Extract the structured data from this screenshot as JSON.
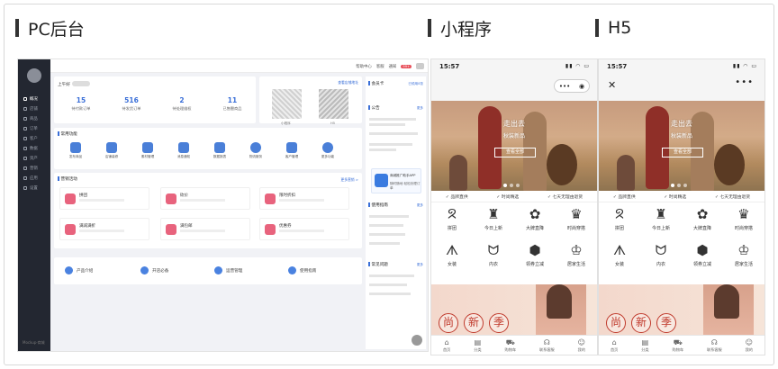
{
  "headers": {
    "pc": "PC后台",
    "mini": "小程序",
    "h5": "H5"
  },
  "pc": {
    "sidebar": [
      "概况",
      "店铺",
      "商品",
      "订单",
      "客户",
      "数据",
      "资产",
      "营销",
      "应用",
      "设置"
    ],
    "sidebar_footer": "Mockup·商城",
    "topbar": {
      "help": "帮助中心",
      "service": "客服",
      "notice": "通知",
      "badge": "99+"
    },
    "greeting": "上午好",
    "stats": [
      {
        "value": "15",
        "label": "待付款订单"
      },
      {
        "value": "516",
        "label": "待发货订单"
      },
      {
        "value": "2",
        "label": "待处理维权"
      },
      {
        "value": "11",
        "label": "已售罄商品"
      }
    ],
    "qr_link": "查看店铺地址",
    "qr_labels": [
      "小程序",
      "H5"
    ],
    "common_title": "常用功能",
    "common": [
      "发布商品",
      "店铺装修",
      "素材管理",
      "消息通知",
      "数据报表",
      "物流服务",
      "客户管理",
      "更多功能"
    ],
    "marketing_title": "营销活动",
    "marketing_more": "更多营销 >",
    "marketing": [
      "拼团",
      "砍价",
      "限时折扣",
      "满减满折",
      "满包邮",
      "优惠券"
    ],
    "bottom": [
      "产品介绍",
      "开店必备",
      "运营管理",
      "使用指南"
    ],
    "right": {
      "member": "会员卡",
      "member_link": "已领用0张",
      "notice": "公告",
      "notice_more": "更多",
      "app_name": "商城推广助手APP",
      "app_desc": "随时随地 轻松处理订单",
      "guide": "使用指南",
      "guide_more": "更多",
      "faq": "常见问题",
      "faq_more": "更多"
    }
  },
  "phones": {
    "time": "15:57",
    "hero_title": "走出去",
    "hero_sub": "秋装新品",
    "hero_btn": "查看全部",
    "services": [
      "品牌直供",
      "时尚精选",
      "七天无理由退货"
    ],
    "categories": [
      {
        "icon": "ᘝ",
        "label": "拼团"
      },
      {
        "icon": "♜",
        "label": "今日上新"
      },
      {
        "icon": "✿",
        "label": "大牌直降"
      },
      {
        "icon": "♛",
        "label": "时尚穿搭"
      },
      {
        "icon": "ᗑ",
        "label": "女装"
      },
      {
        "icon": "ᗢ",
        "label": "内衣"
      },
      {
        "icon": "⬢",
        "label": "领券立减"
      },
      {
        "icon": "♔",
        "label": "居家生活"
      }
    ],
    "promo_chars": [
      "尚",
      "新",
      "季"
    ],
    "tabs": [
      {
        "icon": "⌂",
        "label": "首页"
      },
      {
        "icon": "▤",
        "label": "分类"
      },
      {
        "icon": "⛟",
        "label": "购物车"
      },
      {
        "icon": "☊",
        "label": "联系客服"
      },
      {
        "icon": "☺",
        "label": "我的"
      }
    ]
  },
  "colors": {
    "accent": "#3a6fd8",
    "sidebar": "#232731",
    "marketing": "#e8637d",
    "promo": "#c0392b"
  }
}
